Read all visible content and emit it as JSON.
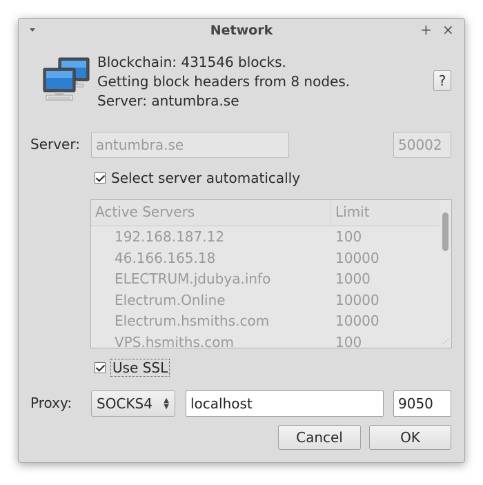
{
  "window": {
    "title": "Network"
  },
  "titlebar": {
    "maximize_glyph": "+",
    "close_glyph": "×"
  },
  "icon": {
    "name": "network-computers-icon"
  },
  "status": {
    "line1": "Blockchain: 431546 blocks.",
    "line2": "Getting block headers from 8 nodes.",
    "line3": "Server: antumbra.se"
  },
  "help_button": {
    "label": "?"
  },
  "server": {
    "label": "Server:",
    "host": "antumbra.se",
    "port": "50002"
  },
  "auto_select": {
    "label": "Select server automatically",
    "checked": true
  },
  "servers_table": {
    "headers": [
      "Active Servers",
      "Limit"
    ],
    "rows": [
      {
        "server": "192.168.187.12",
        "limit": "100"
      },
      {
        "server": "46.166.165.18",
        "limit": "10000"
      },
      {
        "server": "ELECTRUM.jdubya.info",
        "limit": "1000"
      },
      {
        "server": "Electrum.Online",
        "limit": "10000"
      },
      {
        "server": "Electrum.hsmiths.com",
        "limit": "10000"
      },
      {
        "server": "VPS.hsmiths.com",
        "limit": "100"
      }
    ]
  },
  "use_ssl": {
    "label": "Use SSL",
    "checked": true
  },
  "proxy": {
    "label": "Proxy:",
    "type": "SOCKS4",
    "host": "localhost",
    "port": "9050"
  },
  "buttons": {
    "cancel": "Cancel",
    "ok": "OK"
  },
  "colors": {
    "window_bg": "#dcdcdc",
    "disabled_text": "#9a9a9a"
  }
}
